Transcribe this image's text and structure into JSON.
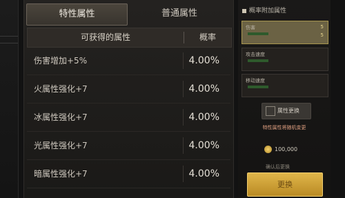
{
  "tabs": [
    {
      "label": "特性属性",
      "active": true
    },
    {
      "label": "普通属性",
      "active": false
    }
  ],
  "table": {
    "headers": [
      "可获得的属性",
      "概率"
    ],
    "rows": [
      {
        "name": "伤害增加+5%",
        "prob": "4.00%"
      },
      {
        "name": "火属性强化+7",
        "prob": "4.00%"
      },
      {
        "name": "冰属性强化+7",
        "prob": "4.00%"
      },
      {
        "name": "光属性强化+7",
        "prob": "4.00%"
      },
      {
        "name": "暗属性强化+7",
        "prob": "4.00%"
      }
    ]
  },
  "right_panel": {
    "title": "概率附加属性",
    "slots": [
      {
        "title": "伤害",
        "top_num": "5",
        "bottom_num": "5",
        "selected": true
      },
      {
        "title": "攻击速度",
        "top_num": "",
        "bottom_num": "",
        "selected": false
      },
      {
        "title": "移动速度",
        "top_num": "",
        "bottom_num": "",
        "selected": false
      }
    ],
    "action_label": "属性更换",
    "warning": "特性属性将随机变更",
    "cost": "100,000",
    "hint": "确认后更换",
    "confirm_label": "更换"
  },
  "colors": {
    "accent_gold": "#e0b64a",
    "selected_slot": "#6b6244",
    "warning_text": "#e0a081"
  }
}
